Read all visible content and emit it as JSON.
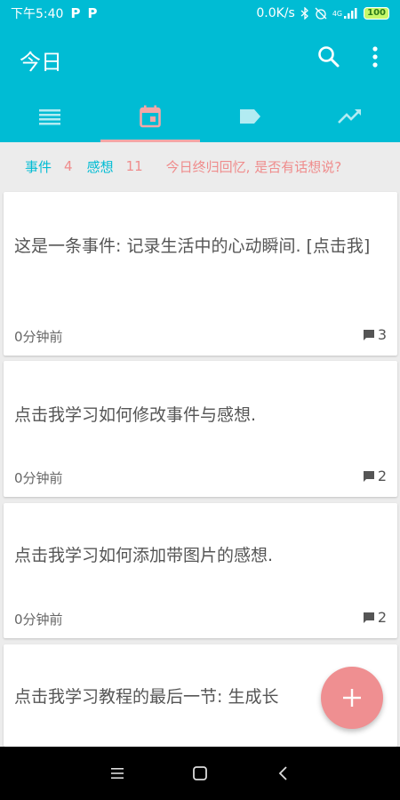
{
  "status_bar": {
    "time": "下午5:40",
    "p_icons": [
      "P",
      "P"
    ],
    "network_speed": "0.0K/s",
    "network_type": "4G",
    "battery": "100"
  },
  "app_bar": {
    "title": "今日"
  },
  "tabs": [
    {
      "icon": "list-icon",
      "active": false
    },
    {
      "icon": "calendar-icon",
      "active": true
    },
    {
      "icon": "label-icon",
      "active": false
    },
    {
      "icon": "trending-up-icon",
      "active": false
    }
  ],
  "summary": {
    "events_label": "事件",
    "events_count": "4",
    "thoughts_label": "感想",
    "thoughts_count": "11",
    "prompt": "今日终归回忆, 是否有话想说?"
  },
  "cards": [
    {
      "text": "这是一条事件: 记录生活中的心动瞬间. [点击我]",
      "time": "0分钟前",
      "comments": "3"
    },
    {
      "text": "点击我学习如何修改事件与感想.",
      "time": "0分钟前",
      "comments": "2"
    },
    {
      "text": "点击我学习如何添加带图片的感想.",
      "time": "0分钟前",
      "comments": "2"
    },
    {
      "text": "点击我学习教程的最后一节: 生成长",
      "time": "",
      "comments": ""
    }
  ],
  "colors": {
    "primary": "#00bcd4",
    "accent": "#ef8f91",
    "summary_prompt": "#ef8c8c"
  }
}
